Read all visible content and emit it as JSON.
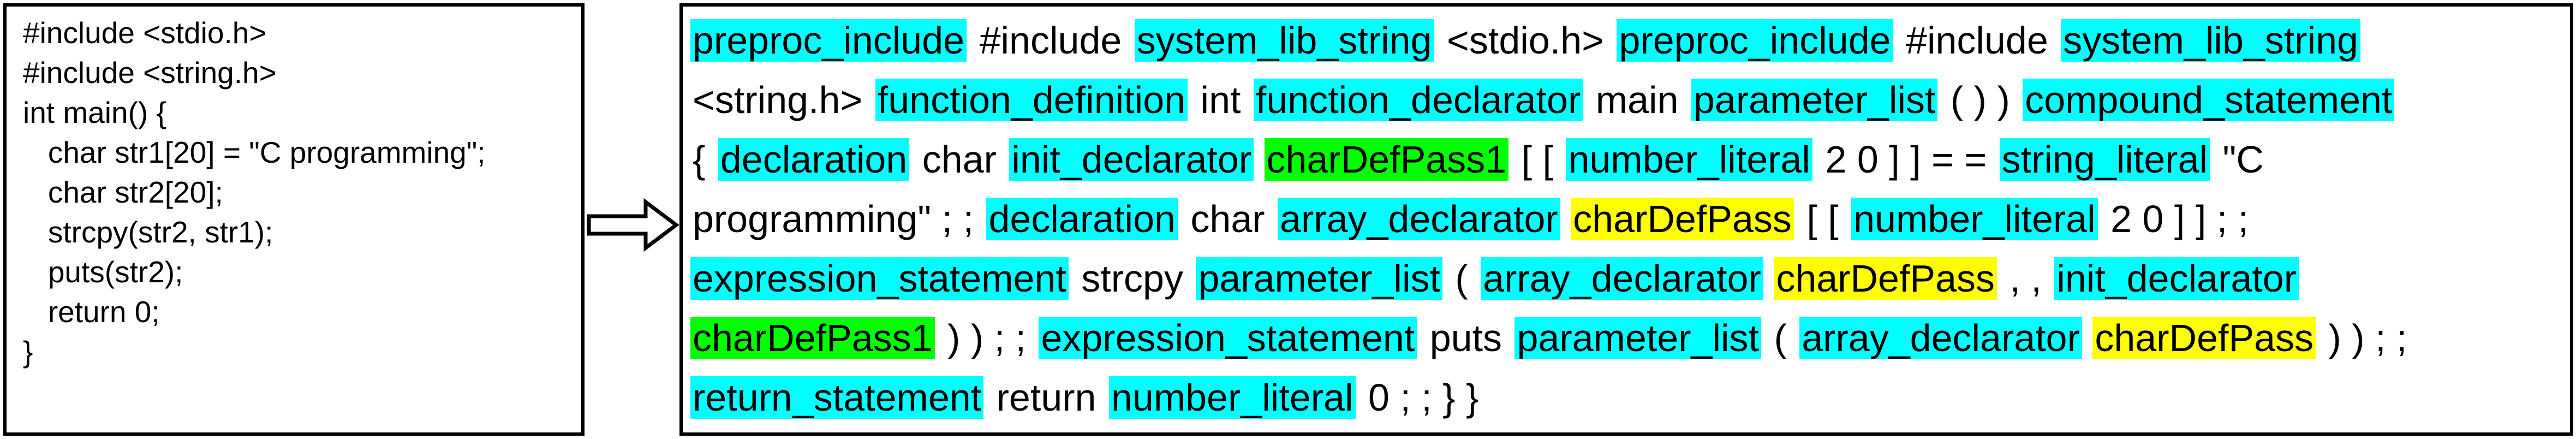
{
  "source_code": {
    "lines": [
      "#include <stdio.h>",
      "#include <string.h>",
      "int main() {",
      "   char str1[20] = \"C programming\";",
      "   char str2[20];",
      "   strcpy(str2, str1);",
      "   puts(str2);",
      "   return 0;",
      "}"
    ]
  },
  "colors": {
    "ast_node": "#00ffff",
    "charDefPass1": "#00ff00",
    "charDefPass": "#ffff00",
    "text": "#000000",
    "border": "#000000"
  },
  "token_lines": [
    [
      {
        "text": "preproc_include",
        "hl": "cyan"
      },
      {
        "text": "#include",
        "hl": ""
      },
      {
        "text": "system_lib_string",
        "hl": "cyan"
      },
      {
        "text": "<stdio.h>",
        "hl": ""
      },
      {
        "text": "preproc_include",
        "hl": "cyan"
      },
      {
        "text": "#include",
        "hl": ""
      },
      {
        "text": "system_lib_string",
        "hl": "cyan"
      }
    ],
    [
      {
        "text": "<string.h>",
        "hl": ""
      },
      {
        "text": "function_definition",
        "hl": "cyan"
      },
      {
        "text": "int",
        "hl": ""
      },
      {
        "text": "function_declarator",
        "hl": "cyan"
      },
      {
        "text": "main",
        "hl": ""
      },
      {
        "text": "parameter_list",
        "hl": "cyan"
      },
      {
        "text": "( ) )",
        "hl": ""
      },
      {
        "text": "compound_statement",
        "hl": "cyan"
      }
    ],
    [
      {
        "text": "{",
        "hl": ""
      },
      {
        "text": "declaration",
        "hl": "cyan"
      },
      {
        "text": "char",
        "hl": ""
      },
      {
        "text": "init_declarator",
        "hl": "cyan"
      },
      {
        "text": "charDefPass1",
        "hl": "green"
      },
      {
        "text": "[ [",
        "hl": ""
      },
      {
        "text": "number_literal",
        "hl": "cyan"
      },
      {
        "text": "2 0 ] ] = =",
        "hl": ""
      },
      {
        "text": "string_literal",
        "hl": "cyan"
      },
      {
        "text": "\"C",
        "hl": ""
      }
    ],
    [
      {
        "text": "programming\" ; ;",
        "hl": ""
      },
      {
        "text": "declaration",
        "hl": "cyan"
      },
      {
        "text": "char",
        "hl": ""
      },
      {
        "text": "array_declarator",
        "hl": "cyan"
      },
      {
        "text": "charDefPass",
        "hl": "yellow"
      },
      {
        "text": "[ [",
        "hl": ""
      },
      {
        "text": "number_literal",
        "hl": "cyan"
      },
      {
        "text": "2 0 ] ] ; ;",
        "hl": ""
      }
    ],
    [
      {
        "text": "expression_statement",
        "hl": "cyan"
      },
      {
        "text": "strcpy",
        "hl": ""
      },
      {
        "text": "parameter_list",
        "hl": "cyan"
      },
      {
        "text": "(",
        "hl": ""
      },
      {
        "text": "array_declarator",
        "hl": "cyan"
      },
      {
        "text": "charDefPass",
        "hl": "yellow"
      },
      {
        "text": ", ,",
        "hl": ""
      },
      {
        "text": "init_declarator",
        "hl": "cyan"
      }
    ],
    [
      {
        "text": "charDefPass1",
        "hl": "green"
      },
      {
        "text": ") ) ; ;",
        "hl": ""
      },
      {
        "text": "expression_statement",
        "hl": "cyan"
      },
      {
        "text": "puts",
        "hl": ""
      },
      {
        "text": "parameter_list",
        "hl": "cyan"
      },
      {
        "text": "(",
        "hl": ""
      },
      {
        "text": "array_declarator",
        "hl": "cyan"
      },
      {
        "text": "charDefPass",
        "hl": "yellow"
      },
      {
        "text": ") ) ; ;",
        "hl": ""
      }
    ],
    [
      {
        "text": "return_statement",
        "hl": "cyan"
      },
      {
        "text": "return",
        "hl": ""
      },
      {
        "text": "number_literal",
        "hl": "cyan"
      },
      {
        "text": "0 ; ; } }",
        "hl": ""
      }
    ]
  ]
}
